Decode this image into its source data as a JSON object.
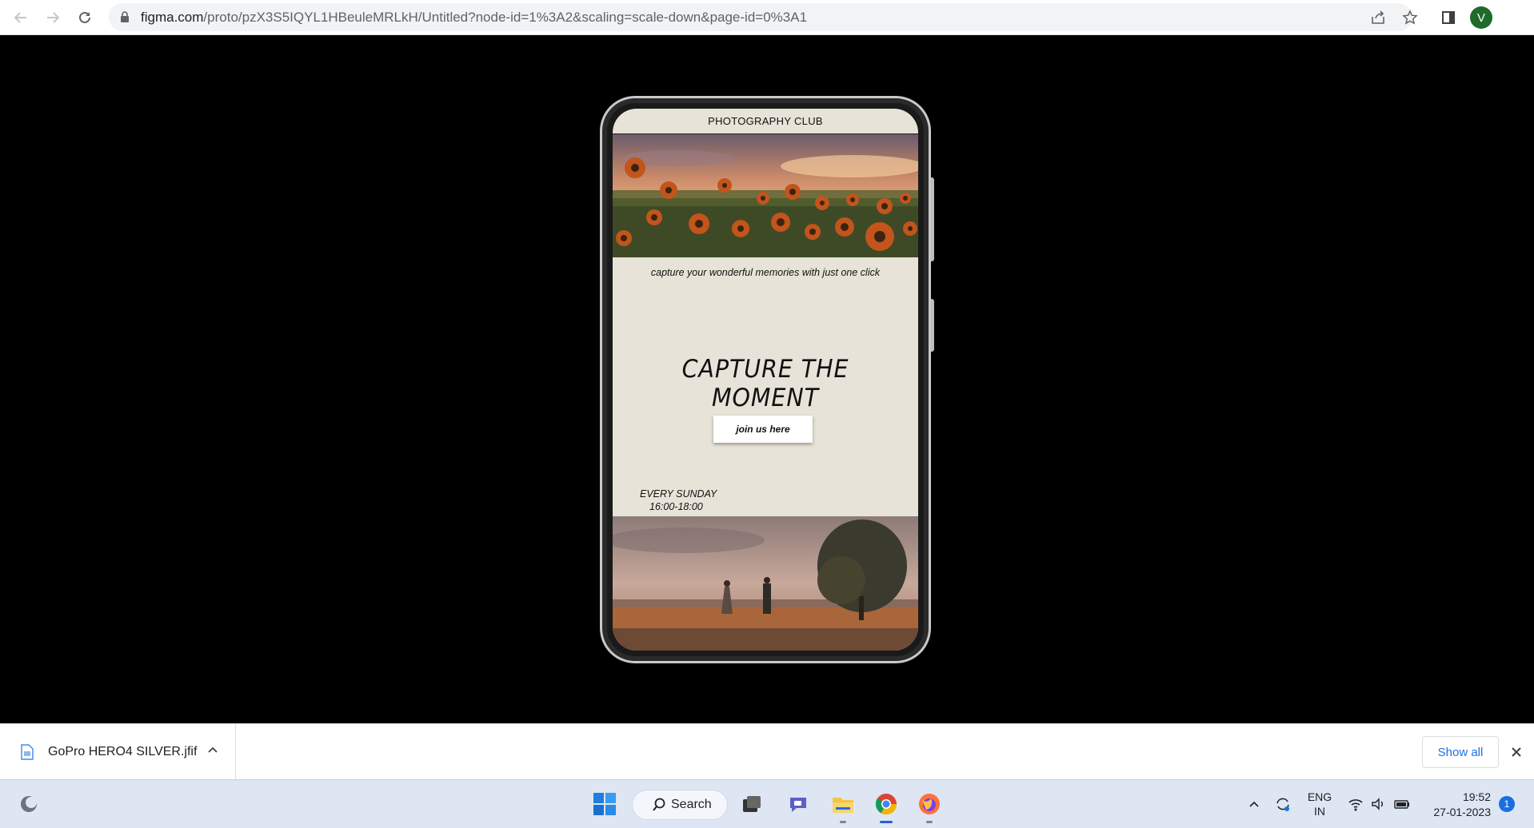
{
  "browser": {
    "url_host": "figma.com",
    "url_path": "/proto/pzX3S5IQYL1HBeuleMRLkH/Untitled?node-id=1%3A2&scaling=scale-down&page-id=0%3A1",
    "avatar_letter": "V",
    "avatar_color": "#1e6b2a"
  },
  "prototype": {
    "header_title": "PHOTOGRAPHY CLUB",
    "hero_image": "sunflower-field-sunset-photo",
    "tagline": "capture your wonderful memories with just one click",
    "headline": "CAPTURE THE MOMENT",
    "cta_label": "join us here",
    "schedule_day": "EVERY SUNDAY",
    "schedule_time": "16:00-18:00",
    "bottom_image": "couple-in-field-with-tree-photo",
    "background_color": "#e7e3d8"
  },
  "downloads": {
    "file_name": "GoPro HERO4 SILVER.jfif",
    "show_all_label": "Show all"
  },
  "taskbar": {
    "search_label": "Search",
    "language_line1": "ENG",
    "language_line2": "IN",
    "time": "19:52",
    "date": "27-01-2023",
    "notification_count": "1",
    "apps": [
      "start-icon",
      "task-view-icon",
      "chat-icon",
      "file-explorer-icon",
      "chrome-icon",
      "firefox-icon"
    ]
  }
}
